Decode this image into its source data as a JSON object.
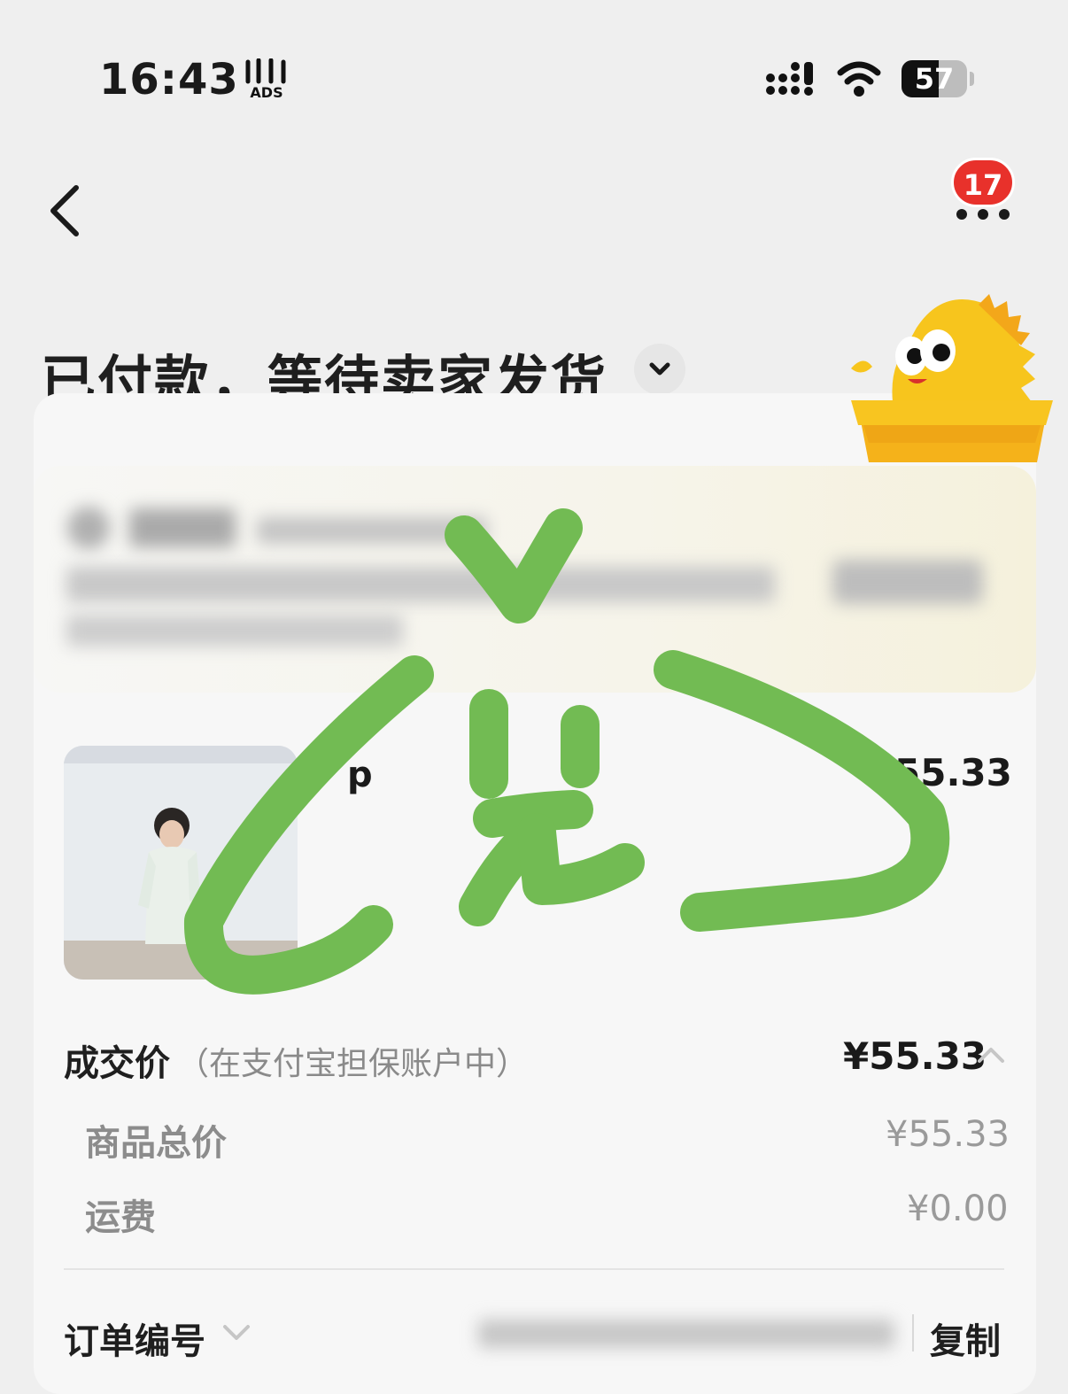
{
  "status_bar": {
    "time": "16:43",
    "battery": "57",
    "battery_level": 0.57
  },
  "nav": {
    "badge_count": "17"
  },
  "header": {
    "title": "已付款，等待卖家发货"
  },
  "product": {
    "title_fragment": "p",
    "price_fragment": "55.33"
  },
  "price": {
    "label": "成交价",
    "note": "（在支付宝担保账户中）",
    "value": "¥55.33",
    "rows": [
      {
        "label": "商品总价",
        "value": "¥55.33"
      },
      {
        "label": "运费",
        "value": "¥0.00"
      }
    ]
  },
  "order": {
    "label": "订单编号",
    "copy_label": "复制"
  },
  "colors": {
    "badge": "#e8312b",
    "scribble": "#72bb53",
    "mascot": "#f7c51d"
  }
}
